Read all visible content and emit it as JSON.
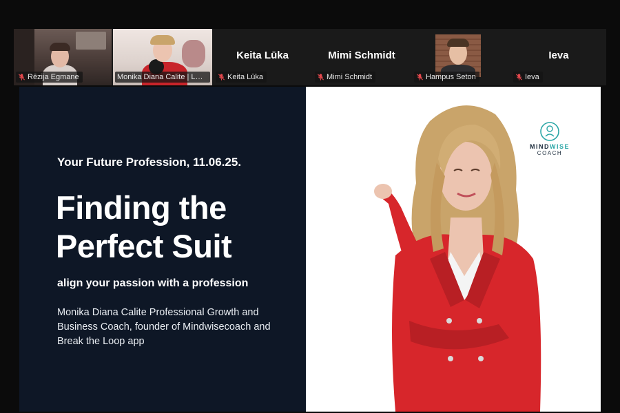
{
  "participants": [
    {
      "name": "Rēzija Egmane",
      "muted": true,
      "video": true
    },
    {
      "name": "Monika Diana Calite | Lai...",
      "muted": false,
      "video": true,
      "active_speaker": true
    },
    {
      "name": "Keita Lūka",
      "muted": true,
      "video": false
    },
    {
      "name": "Mimi Schmidt",
      "muted": true,
      "video": false
    },
    {
      "name": "Hampus Seton",
      "muted": true,
      "video": true
    },
    {
      "name": "Ieva",
      "muted": true,
      "video": false
    }
  ],
  "slide": {
    "event_line": "Your Future Profession, 11.06.25.",
    "headline": "Finding the Perfect Suit",
    "tagline": "align your passion with a profession",
    "bio": "Monika Diana Calite Professional Growth and Business Coach, founder of Mindwisecoach and Break the Loop app",
    "logo": {
      "brand_part1": "MIND",
      "brand_part2": "WISE",
      "sub": "COACH"
    }
  },
  "colors": {
    "slide_bg": "#0e1726",
    "active_speaker_border": "#2ecc71",
    "muted_mic": "#e5484d",
    "jacket_red": "#d7262b",
    "logo_teal": "#2aa6a6"
  },
  "icons": [
    "muted-mic-icon",
    "mindwise-logo-icon"
  ]
}
